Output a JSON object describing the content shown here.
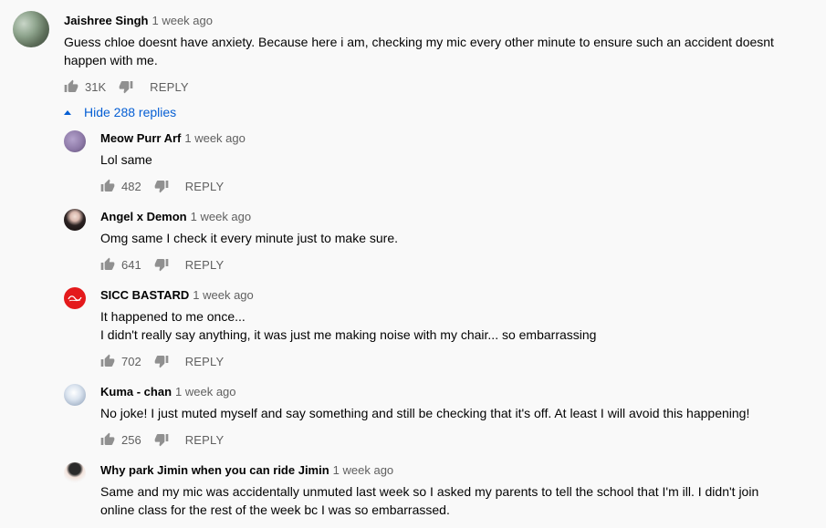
{
  "main_comment": {
    "author": "Jaishree Singh",
    "time": "1 week ago",
    "text_lines": [
      "Guess chloe doesnt have anxiety. Because here i am, checking my mic every other minute to ensure such an accident doesnt",
      "happen with me."
    ],
    "likes": "31K",
    "reply_label": "REPLY"
  },
  "replies_toggle": {
    "label": "Hide 288 replies",
    "icon": "caret-up-icon"
  },
  "replies": [
    {
      "author": "Meow Purr Arf",
      "time": "1 week ago",
      "text_lines": [
        "Lol same"
      ],
      "likes": "482",
      "reply_label": "REPLY",
      "avatar_color": "#8e7aa8"
    },
    {
      "author": "Angel x Demon",
      "time": "1 week ago",
      "text_lines": [
        "Omg same I check it every minute just to make sure."
      ],
      "likes": "641",
      "reply_label": "REPLY",
      "avatar_color": "#3a3030"
    },
    {
      "author": "SICC BASTARD",
      "time": "1 week ago",
      "text_lines": [
        "It happened to me once...",
        "I didn't really say anything, it was just me making noise with my chair... so embarrassing"
      ],
      "likes": "702",
      "reply_label": "REPLY",
      "avatar_color": "#e41a1c"
    },
    {
      "author": "Kuma - chan",
      "time": "1 week ago",
      "text_lines": [
        "No joke! I just muted myself and say something and still be checking that it's off. At least I will avoid this happening!"
      ],
      "likes": "256",
      "reply_label": "REPLY",
      "avatar_color": "#b9c6d8"
    },
    {
      "author": "Why park Jimin when you can ride Jimin",
      "time": "1 week ago",
      "text_lines": [
        "Same and my mic was accidentally unmuted last week so I asked my parents to tell the school that I'm ill. I didn't join",
        "online class for the rest of the week bc I was so embarrassed."
      ],
      "likes": "",
      "reply_label": "",
      "avatar_color": "#f2f2f2"
    }
  ],
  "colors": {
    "text": "#030303",
    "secondary": "#606060",
    "link": "#065fd4",
    "background": "#f9f9f9"
  }
}
